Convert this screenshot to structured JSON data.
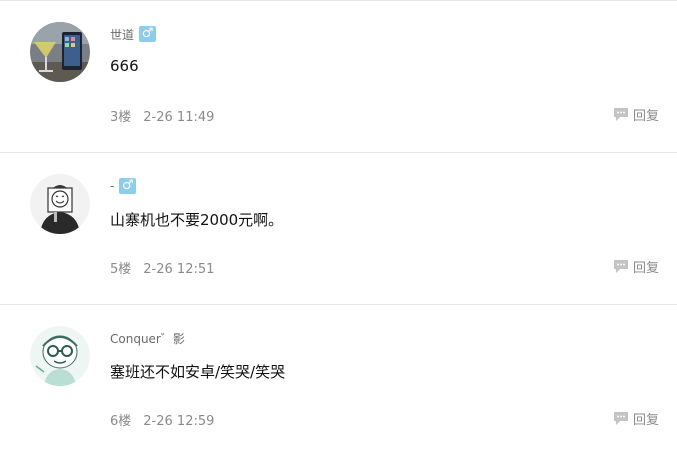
{
  "comments": [
    {
      "username": "世道",
      "gender_symbol": "♂",
      "content": "666",
      "floor": "3楼",
      "time": "2-26 11:49",
      "reply_label": "回复",
      "avatar_icon": "avatar-cocktail-phone-photo"
    },
    {
      "username": "-",
      "gender_symbol": "♂",
      "content": "山寨机也不要2000元啊。",
      "floor": "5楼",
      "time": "2-26 12:51",
      "reply_label": "回复",
      "avatar_icon": "avatar-sketch-smiley-sign"
    },
    {
      "username": "Conquer゛影",
      "gender_symbol": "",
      "content": "塞班还不如安卓/笑哭/笑哭",
      "floor": "6楼",
      "time": "2-26 12:59",
      "reply_label": "回复",
      "avatar_icon": "avatar-cartoon-glasses-face"
    }
  ],
  "colors": {
    "gender_badge": "#8ecde9",
    "meta_text": "#8a8a8a",
    "divider": "#e6e6e6"
  }
}
